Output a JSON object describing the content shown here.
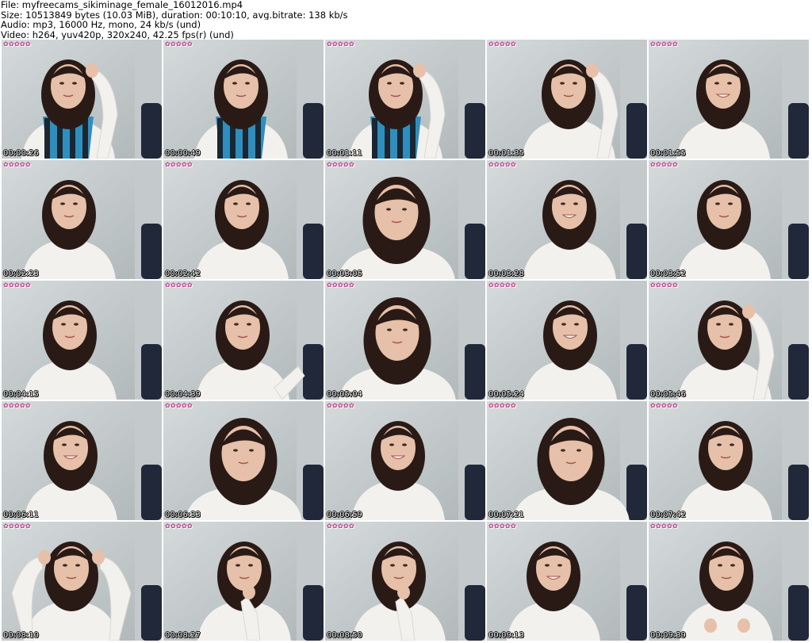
{
  "header": {
    "file": "File: myfreecams_sikiminage_female_16012016.mp4",
    "size": "Size: 10513849 bytes (10.03 MiB), duration: 00:10:10, avg.bitrate: 138 kb/s",
    "audio": "Audio: mp3, 16000 Hz, mono, 24 kb/s (und)",
    "video": "Video: h264, yuv420p, 320x240, 42.25 fps(r) (und)"
  },
  "thumbnails": [
    {
      "timestamp": "00:00:26",
      "pose": "scarf-hand"
    },
    {
      "timestamp": "00:00:49",
      "pose": "scarf"
    },
    {
      "timestamp": "00:01:11",
      "pose": "scarf-hand"
    },
    {
      "timestamp": "00:01:35",
      "pose": "hand-head"
    },
    {
      "timestamp": "00:01:55",
      "pose": "smile"
    },
    {
      "timestamp": "00:02:23",
      "pose": "neutral"
    },
    {
      "timestamp": "00:02:42",
      "pose": "neutral"
    },
    {
      "timestamp": "00:03:05",
      "pose": "close"
    },
    {
      "timestamp": "00:03:28",
      "pose": "smile"
    },
    {
      "timestamp": "00:03:52",
      "pose": "neutral"
    },
    {
      "timestamp": "00:04:15",
      "pose": "neutral"
    },
    {
      "timestamp": "00:04:39",
      "pose": "arm"
    },
    {
      "timestamp": "00:05:04",
      "pose": "close"
    },
    {
      "timestamp": "00:05:24",
      "pose": "smile"
    },
    {
      "timestamp": "00:05:46",
      "pose": "hand-head"
    },
    {
      "timestamp": "00:06:11",
      "pose": "smile"
    },
    {
      "timestamp": "00:06:33",
      "pose": "close"
    },
    {
      "timestamp": "00:06:59",
      "pose": "smile"
    },
    {
      "timestamp": "00:07:21",
      "pose": "close"
    },
    {
      "timestamp": "00:07:42",
      "pose": "neutral"
    },
    {
      "timestamp": "00:08:10",
      "pose": "arms-up"
    },
    {
      "timestamp": "00:08:27",
      "pose": "hand-chin"
    },
    {
      "timestamp": "00:08:50",
      "pose": "hand-chin"
    },
    {
      "timestamp": "00:09:13",
      "pose": "smile"
    },
    {
      "timestamp": "00:09:39",
      "pose": "hands-chest"
    }
  ],
  "colors": {
    "wall": "#d5dadb",
    "wall_dark": "#aeb6b8",
    "hair": "#2a1a16",
    "skin": "#e6c0a8",
    "sweater": "#f3f1ee",
    "scarf_blue": "#2e8fbf",
    "scarf_dark": "#1b2630",
    "chair": "#20283a"
  }
}
